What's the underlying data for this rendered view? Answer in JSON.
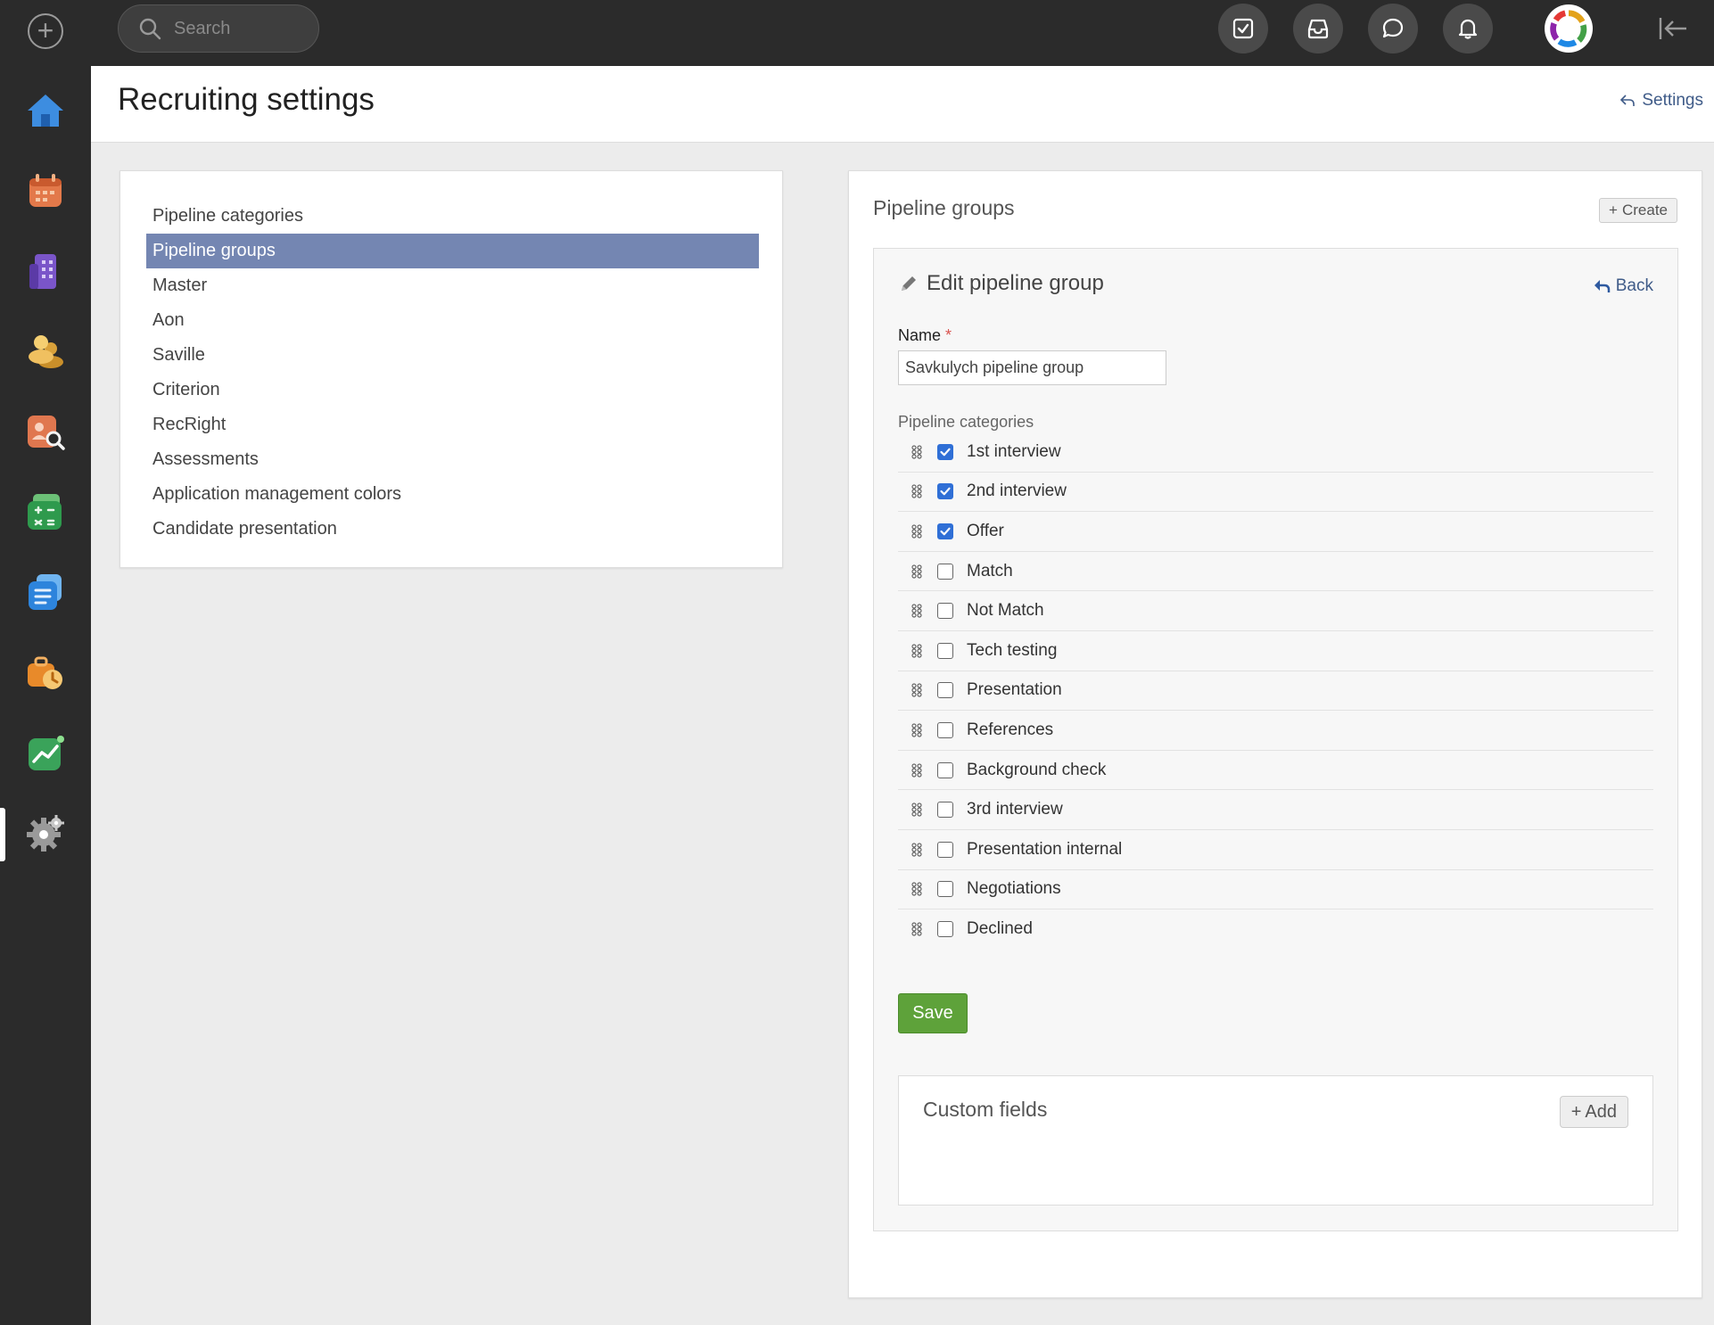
{
  "topbar": {
    "search_placeholder": "Search",
    "buttons": [
      "tasks-icon",
      "inbox-icon",
      "chat-icon",
      "bell-icon"
    ]
  },
  "rail": {
    "items": [
      "home-icon",
      "calendar-icon",
      "building-icon",
      "people-icon",
      "candidate-search-icon",
      "spreadsheet-icon",
      "documents-icon",
      "timesheet-icon",
      "analytics-icon",
      "settings-gear-icon"
    ],
    "active": "settings-gear-icon"
  },
  "header": {
    "title": "Recruiting settings",
    "settings_link": "Settings"
  },
  "menu": {
    "items": [
      "Pipeline categories",
      "Pipeline groups",
      "Master",
      "Aon",
      "Saville",
      "Criterion",
      "RecRight",
      "Assessments",
      "Application management colors",
      "Candidate presentation"
    ],
    "active_index": 1
  },
  "panel": {
    "title": "Pipeline groups",
    "create_label": "Create",
    "edit": {
      "title": "Edit pipeline group",
      "back_label": "Back",
      "name_label": "Name",
      "required_mark": "*",
      "name_value": "Savkulych pipeline group",
      "categories_label": "Pipeline categories",
      "categories": [
        {
          "label": "1st interview",
          "checked": true
        },
        {
          "label": "2nd interview",
          "checked": true
        },
        {
          "label": "Offer",
          "checked": true
        },
        {
          "label": "Match",
          "checked": false
        },
        {
          "label": "Not Match",
          "checked": false
        },
        {
          "label": "Tech testing",
          "checked": false
        },
        {
          "label": "Presentation",
          "checked": false
        },
        {
          "label": "References",
          "checked": false
        },
        {
          "label": "Background check",
          "checked": false
        },
        {
          "label": "3rd interview",
          "checked": false
        },
        {
          "label": "Presentation internal",
          "checked": false
        },
        {
          "label": "Negotiations",
          "checked": false
        },
        {
          "label": "Declined",
          "checked": false
        }
      ],
      "save_label": "Save"
    },
    "custom_fields": {
      "title": "Custom fields",
      "add_label": "Add"
    }
  },
  "colors": {
    "accent_active": "#7486b2",
    "save_green": "#5ea23a",
    "checkbox_blue": "#2f6fd6",
    "link_blue": "#3f5b88",
    "topbar": "#2b2b2b"
  }
}
